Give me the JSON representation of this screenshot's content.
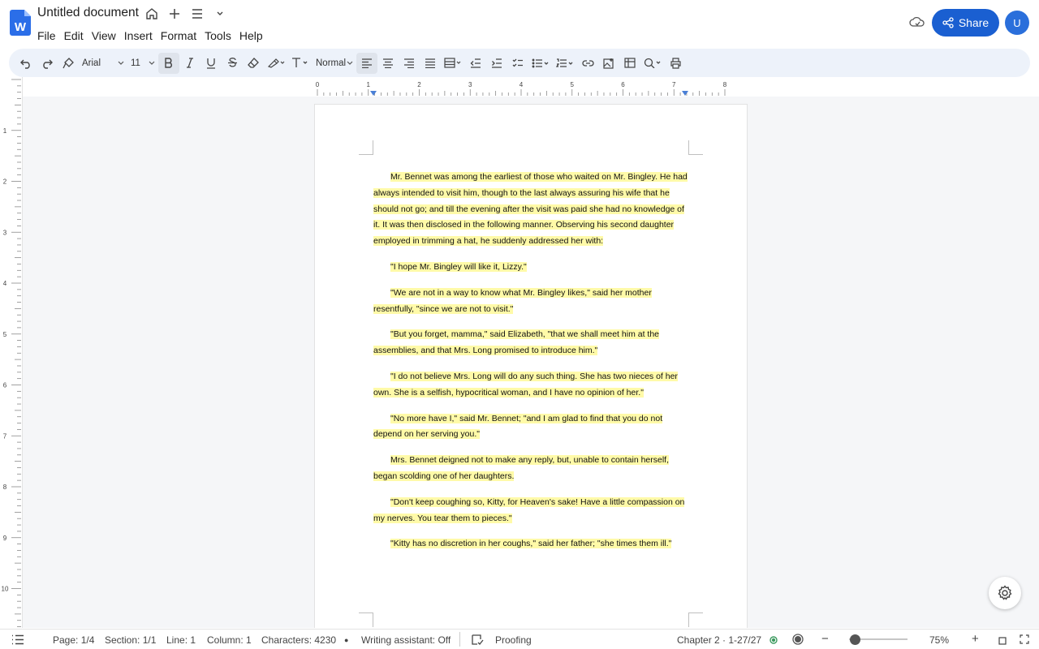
{
  "header": {
    "title": "Untitled document",
    "logo_letter": "W",
    "menu": [
      "File",
      "Edit",
      "View",
      "Insert",
      "Format",
      "Tools",
      "Help"
    ],
    "share_label": "Share",
    "avatar_initial": "U"
  },
  "toolbar": {
    "font_family": "Arial",
    "font_size": "11",
    "paragraph_style": "Normal"
  },
  "ruler": {
    "h_numbers": [
      "0",
      "1",
      "2",
      "3",
      "4",
      "5",
      "6",
      "7",
      "8"
    ],
    "v_numbers": [
      "1",
      "2",
      "3",
      "4",
      "5",
      "6",
      "7",
      "8",
      "9",
      "10"
    ]
  },
  "document": {
    "paragraphs": [
      "Mr. Bennet was among the earliest of those who waited on Mr. Bingley. He had always intended to visit him, though to the last always assuring his wife that he should not go; and till the evening after the visit was paid she had no knowledge of it. It was then disclosed in the following manner. Observing his second daughter employed in trimming a hat, he suddenly addressed her with:",
      "\"I hope Mr. Bingley will like it, Lizzy.\"",
      "\"We are not in a way to know what Mr. Bingley likes,\" said her mother resentfully, \"since we are not to visit.\"",
      "\"But you forget, mamma,\" said Elizabeth, \"that we shall meet him at the assemblies, and that Mrs. Long promised to introduce him.\"",
      "\"I do not believe Mrs. Long will do any such thing. She has two nieces of her own. She is a selfish, hypocritical woman, and I have no opinion of her.\"",
      "\"No more have I,\" said Mr. Bennet; \"and I am glad to find that you do not depend on her serving you.\"",
      "Mrs. Bennet deigned not to make any reply, but, unable to contain herself, began scolding one of her daughters.",
      "\"Don't keep coughing so, Kitty, for Heaven's sake! Have a little compassion on my nerves. You tear them to pieces.\"",
      "\"Kitty has no discretion in her coughs,\" said her father; \"she times them ill.\""
    ],
    "highlight_color": "#fffaa8"
  },
  "status": {
    "page": "Page: 1/4",
    "section": "Section: 1/1",
    "line": "Line: 1",
    "column": "Column: 1",
    "characters": "Characters: 4230",
    "writing_assistant": "Writing assistant: Off",
    "proofing": "Proofing",
    "chapter": "Chapter 2 · 1-27/27",
    "zoom": "75%",
    "zoom_level": 0.1
  },
  "colors": {
    "accent": "#1a5fd1",
    "toolbar_bg": "#edf2fa",
    "canvas_bg": "#f5f6f8"
  }
}
